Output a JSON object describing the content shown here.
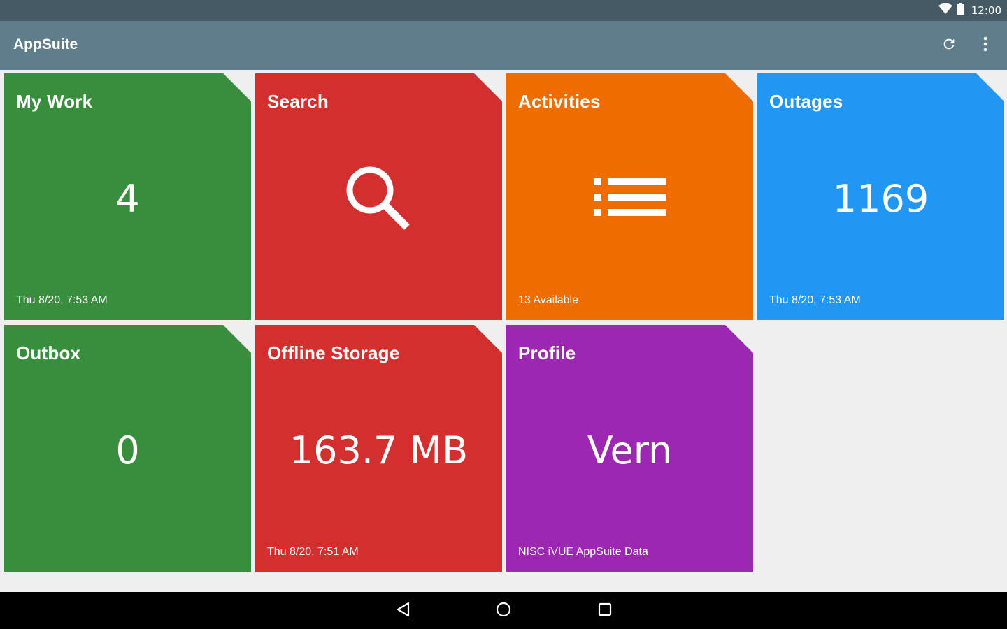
{
  "status_bar": {
    "time": "12:00",
    "icons": [
      "wifi-icon",
      "battery-icon"
    ]
  },
  "app_bar": {
    "title": "AppSuite",
    "actions": [
      "refresh-icon",
      "more-vert-icon"
    ]
  },
  "tiles": [
    {
      "title": "My Work",
      "value": "4",
      "footer": "Thu 8/20, 7:53 AM",
      "color": "#388e3c"
    },
    {
      "title": "Search",
      "icon": "search-icon",
      "footer": "",
      "color": "#d32f2f"
    },
    {
      "title": "Activities",
      "icon": "list-icon",
      "footer": "13 Available",
      "color": "#ef6c00"
    },
    {
      "title": "Outages",
      "value": "1169",
      "footer": "Thu 8/20, 7:53 AM",
      "color": "#2196f3"
    },
    {
      "title": "Outbox",
      "value": "0",
      "footer": "",
      "color": "#388e3c"
    },
    {
      "title": "Offline Storage",
      "value": "163.7 MB",
      "footer": "Thu 8/20, 7:51 AM",
      "color": "#d32f2f"
    },
    {
      "title": "Profile",
      "value": "Vern",
      "footer": "NISC iVUE AppSuite Data",
      "color": "#9c27b0"
    }
  ],
  "nav_bar": {
    "buttons": [
      "back-icon",
      "home-icon",
      "recents-icon"
    ]
  }
}
